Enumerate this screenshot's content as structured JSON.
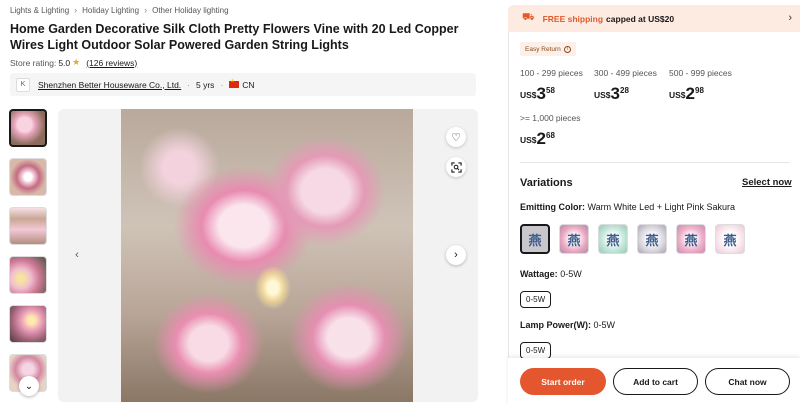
{
  "breadcrumb": [
    "Lights & Lighting",
    "Holiday Lighting",
    "Other Holiday lighting"
  ],
  "product": {
    "title": "Home Garden Decorative Silk Cloth Pretty Flowers Vine with 20 Led Copper Wires Light Outdoor Solar Powered Garden String Lights",
    "rating_label": "Store rating:",
    "rating_value": "5.0",
    "reviews": "(126 reviews)"
  },
  "store": {
    "logo_text": "K",
    "name": "Shenzhen Better Houseware Co., Ltd.",
    "years": "5 yrs",
    "country": "CN"
  },
  "gallery": {
    "thumbnail_count": 6,
    "active_index": 0
  },
  "shipping": {
    "free_text": "FREE shipping",
    "cap_text": "capped at US$20"
  },
  "easy_return": "Easy Return",
  "pricing": [
    {
      "range": "100 - 299 pieces",
      "currency": "US$",
      "int": "3",
      "dec": "58"
    },
    {
      "range": "300 - 499 pieces",
      "currency": "US$",
      "int": "3",
      "dec": "28"
    },
    {
      "range": "500 - 999 pieces",
      "currency": "US$",
      "int": "2",
      "dec": "98"
    },
    {
      "range": ">= 1,000 pieces",
      "currency": "US$",
      "int": "2",
      "dec": "68"
    }
  ],
  "variations": {
    "title": "Variations",
    "select_now": "Select now",
    "emitting_color_label": "Emitting Color:",
    "emitting_color_value": "Warm White Led + Light Pink Sakura",
    "swatch_glyph": "燕",
    "wattage_label": "Wattage:",
    "wattage_value": "0-5W",
    "wattage_chip": "0-5W",
    "lamp_power_label": "Lamp Power(W):",
    "lamp_power_value": "0-5W",
    "lamp_power_chip": "0-5W"
  },
  "actions": {
    "start_order": "Start order",
    "add_to_cart": "Add to cart",
    "chat_now": "Chat now"
  },
  "colors": {
    "accent": "#e4572e",
    "shipping_bg": "#fdebe2",
    "star": "#e8a33d"
  }
}
